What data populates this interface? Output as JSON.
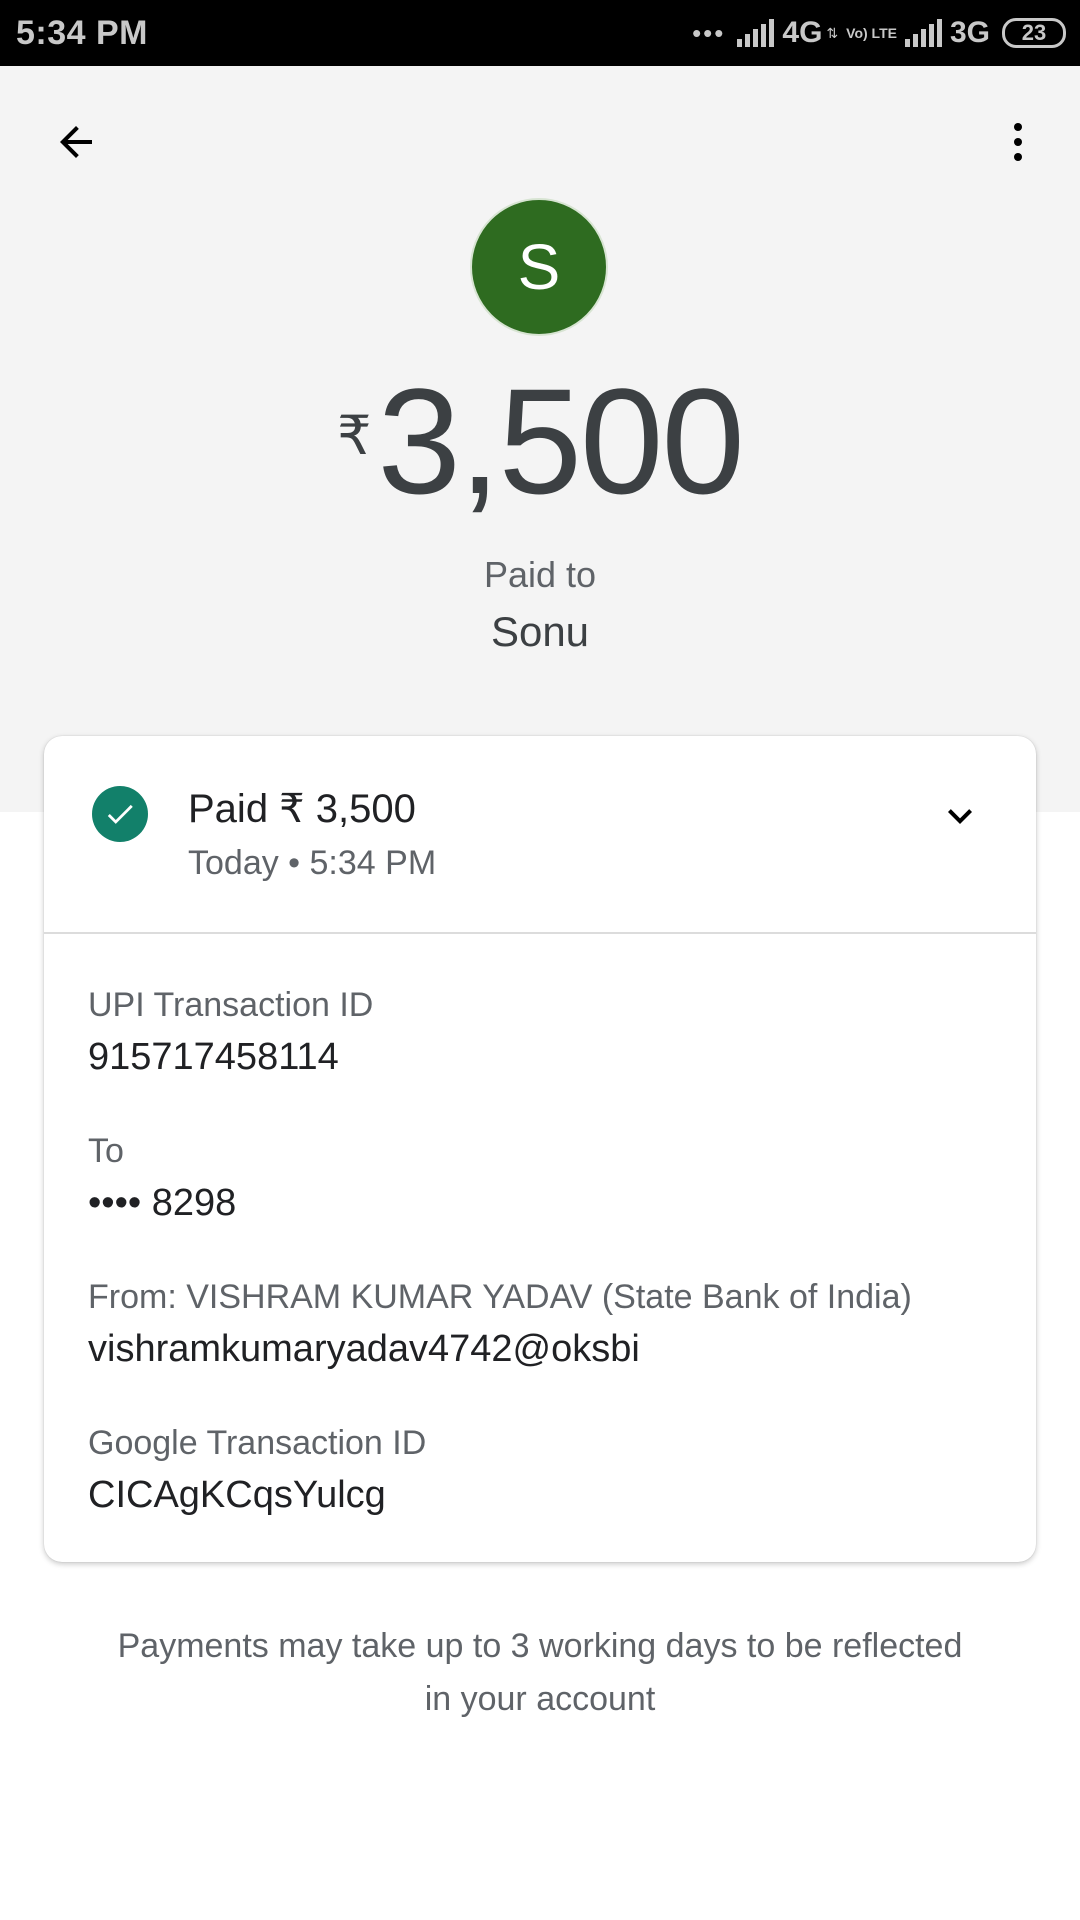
{
  "status_bar": {
    "time": "5:34 PM",
    "network_1": "4G",
    "volte": "Vo) LTE",
    "network_2": "3G",
    "battery": "23"
  },
  "header": {
    "avatar_letter": "S",
    "currency_symbol": "₹",
    "amount": "3,500",
    "paid_to_label": "Paid to",
    "payee_name": "Sonu"
  },
  "card": {
    "status_title": "Paid ₹ 3,500",
    "status_time": "Today • 5:34 PM",
    "fields": [
      {
        "label": "UPI Transaction ID",
        "value": "915717458114"
      },
      {
        "label": "To",
        "value": "•••• 8298"
      },
      {
        "label": "From: VISHRAM KUMAR YADAV (State Bank of India)",
        "value": "vishramkumaryadav4742@oksbi"
      },
      {
        "label": "Google Transaction ID",
        "value": "CICAgKCqsYulcg"
      }
    ]
  },
  "footnote": "Payments may take up to 3 working days to be reflected in your account",
  "colors": {
    "avatar": "#2e6b20",
    "success_check": "#12806a",
    "hero_background": "#f4f4f4"
  },
  "icons": {
    "back": "arrow-left-icon",
    "more": "more-vert-icon",
    "success": "check-circle-icon",
    "expand": "chevron-down-icon"
  }
}
